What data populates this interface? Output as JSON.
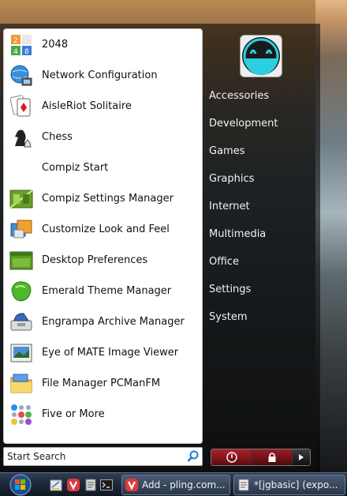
{
  "apps": [
    {
      "label": "2048",
      "icon": "2048-icon"
    },
    {
      "label": "Network Configuration",
      "icon": "network-globe-icon"
    },
    {
      "label": "AisleRiot Solitaire",
      "icon": "playing-card-icon"
    },
    {
      "label": "Chess",
      "icon": "chess-knight-icon"
    },
    {
      "label": "Compiz Start",
      "icon": "blank-icon"
    },
    {
      "label": "Compiz Settings Manager",
      "icon": "compiz-settings-icon"
    },
    {
      "label": "Customize Look and Feel",
      "icon": "appearance-icon"
    },
    {
      "label": "Desktop Preferences",
      "icon": "desktop-preferences-icon"
    },
    {
      "label": "Emerald Theme Manager",
      "icon": "emerald-gem-icon"
    },
    {
      "label": "Engrampa Archive Manager",
      "icon": "archive-icon"
    },
    {
      "label": "Eye of MATE Image Viewer",
      "icon": "image-viewer-icon"
    },
    {
      "label": "File Manager PCManFM",
      "icon": "folder-icon"
    },
    {
      "label": "Five or More",
      "icon": "colored-balls-icon"
    }
  ],
  "categories": [
    "Accessories",
    "Development",
    "Games",
    "Graphics",
    "Internet",
    "Multimedia",
    "Office",
    "Settings",
    "System"
  ],
  "search": {
    "placeholder": "Start Search",
    "value": "Start Search"
  },
  "taskbar": {
    "tasks": [
      {
        "label": "Add - pling.com..."
      },
      {
        "label": "*[jgbasic] (expo..."
      }
    ]
  },
  "colors": {
    "shutdown": "#b0202a",
    "taskbar": "#1c283a",
    "accent": "#1a7fd4"
  }
}
